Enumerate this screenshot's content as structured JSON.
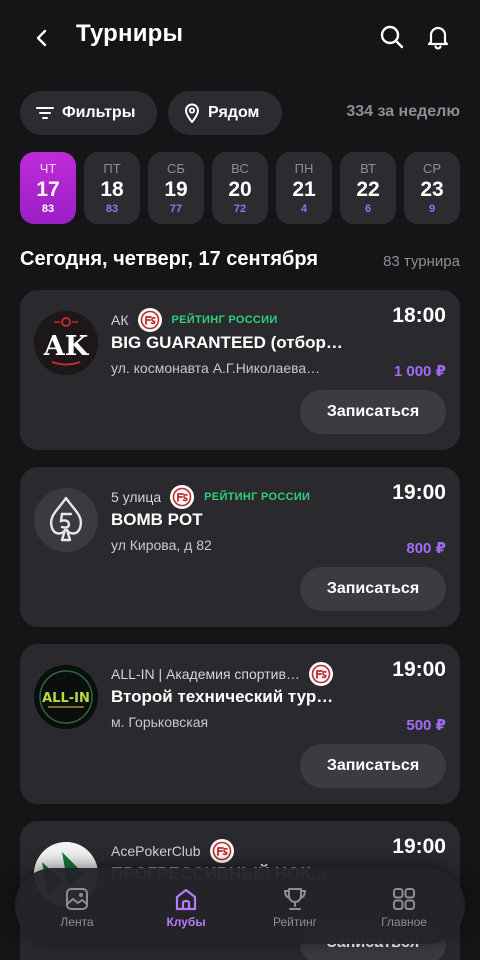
{
  "header": {
    "title": "Турниры",
    "icons": [
      "back-icon",
      "search-icon",
      "bell-icon"
    ]
  },
  "filters": {
    "filters_label": "Фильтры",
    "near_label": "Рядом",
    "week_count": "334 за неделю"
  },
  "dates": [
    {
      "dow": "ЧТ",
      "num": "17",
      "count": "83",
      "active": true
    },
    {
      "dow": "ПТ",
      "num": "18",
      "count": "83"
    },
    {
      "dow": "СБ",
      "num": "19",
      "count": "77"
    },
    {
      "dow": "ВС",
      "num": "20",
      "count": "72"
    },
    {
      "dow": "ПН",
      "num": "21",
      "count": "4"
    },
    {
      "dow": "ВТ",
      "num": "22",
      "count": "6"
    },
    {
      "dow": "СР",
      "num": "23",
      "count": "9"
    }
  ],
  "section": {
    "title": "Сегодня, четверг, 17 сентября",
    "count": "83 турнира"
  },
  "tournaments": [
    {
      "club": "АК",
      "rating": "РЕЙТИНГ РОССИИ",
      "name": "BIG GUARANTEED (отбор…",
      "address": "ул. космонавта А.Г.Николаева…",
      "time": "18:00",
      "price": "1 000 ₽",
      "button": "Записаться",
      "logo": "ak"
    },
    {
      "club": "5 улица",
      "rating": "РЕЙТИНГ РОССИИ",
      "name": "BOMB POT",
      "address": "ул Кирова, д 82",
      "time": "19:00",
      "price": "800 ₽",
      "button": "Записаться",
      "logo": "five"
    },
    {
      "club": "ALL-IN | Академия спортив…",
      "rating": "",
      "name": "Второй технический тур…",
      "address": "м. Горьковская",
      "time": "19:00",
      "price": "500 ₽",
      "button": "Записаться",
      "logo": "allin"
    },
    {
      "club": "AcePokerClub",
      "rating": "",
      "name": "ПРОГРЕССИВНЫЙ НОК…",
      "address": "",
      "time": "19:00",
      "price": "",
      "button": "Записаться",
      "logo": "ace"
    }
  ],
  "logo_text": {
    "ak": "AK",
    "allin": "ALL-IN"
  },
  "nav": [
    {
      "label": "Лента",
      "icon": "image-icon"
    },
    {
      "label": "Клубы",
      "icon": "house-icon",
      "active": true
    },
    {
      "label": "Рейтинг",
      "icon": "trophy-icon"
    },
    {
      "label": "Главное",
      "icon": "grid-icon"
    }
  ],
  "colors": {
    "background": "#151417",
    "card": "#2a292e",
    "accent": "#b57cff",
    "price": "#a26bf5",
    "rating": "#2fd07a",
    "active_date": "#c02bd9"
  }
}
